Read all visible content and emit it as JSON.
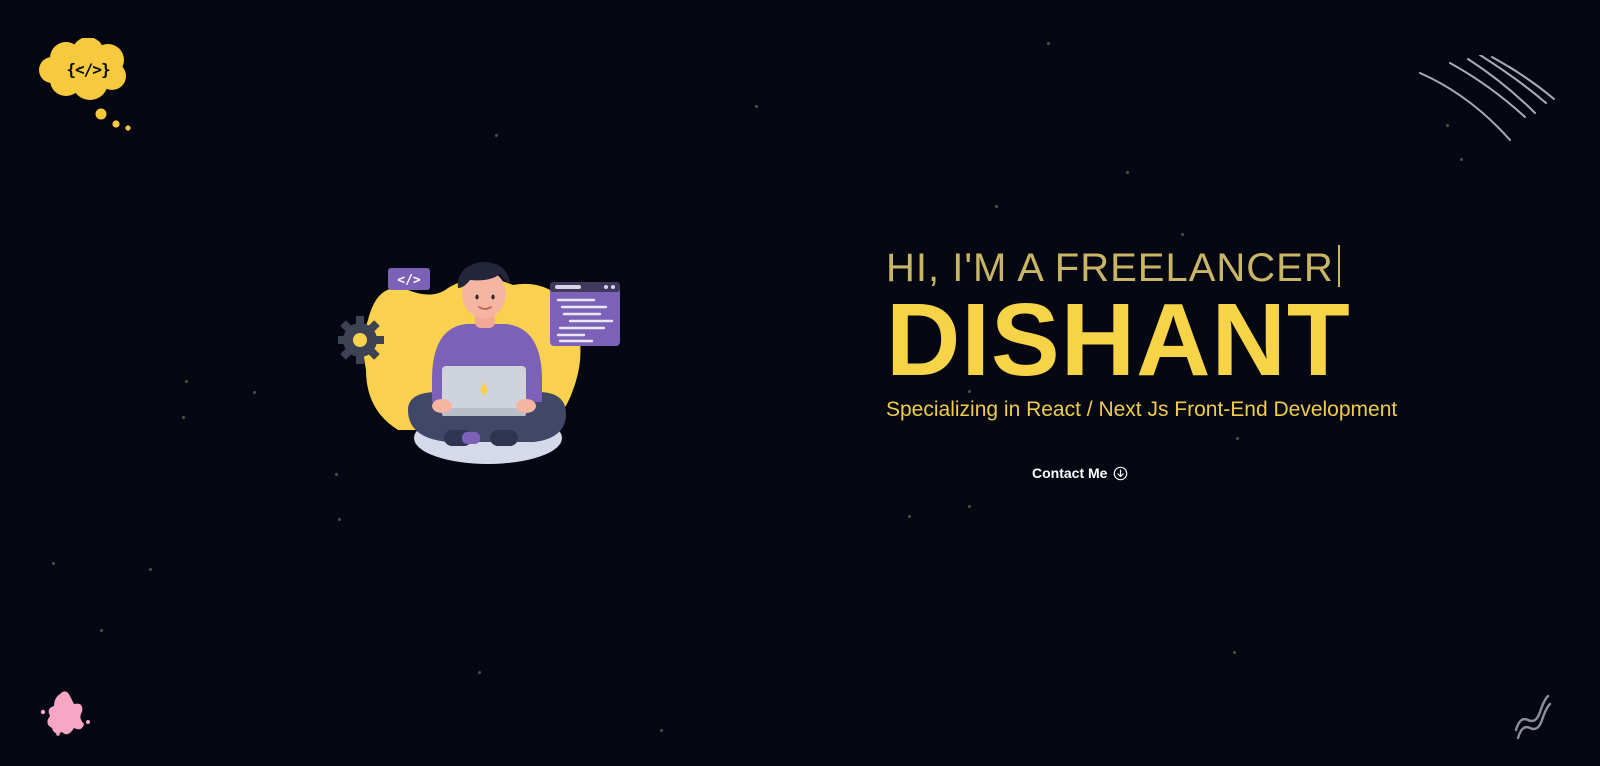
{
  "logo": {
    "code_glyph": "{</>}",
    "icon": "thought-bubble-code-icon"
  },
  "hero": {
    "eyebrow": "HI, I'M A FREELANCER",
    "name": "DISHANT",
    "subtitle": "Specializing in React / Next Js Front-End Development"
  },
  "contact": {
    "label": "Contact Me",
    "icon": "arrow-down-circle-icon"
  },
  "illustration": {
    "code_tag": "</>"
  },
  "colors": {
    "background": "#050812",
    "accent": "#f7d447",
    "accent_muted": "#c9b566",
    "purple": "#7b62b8",
    "pink": "#f7a6c4"
  },
  "decorations": [
    "streaks-icon",
    "splat-icon",
    "squiggle-icon",
    "gear-icon"
  ]
}
